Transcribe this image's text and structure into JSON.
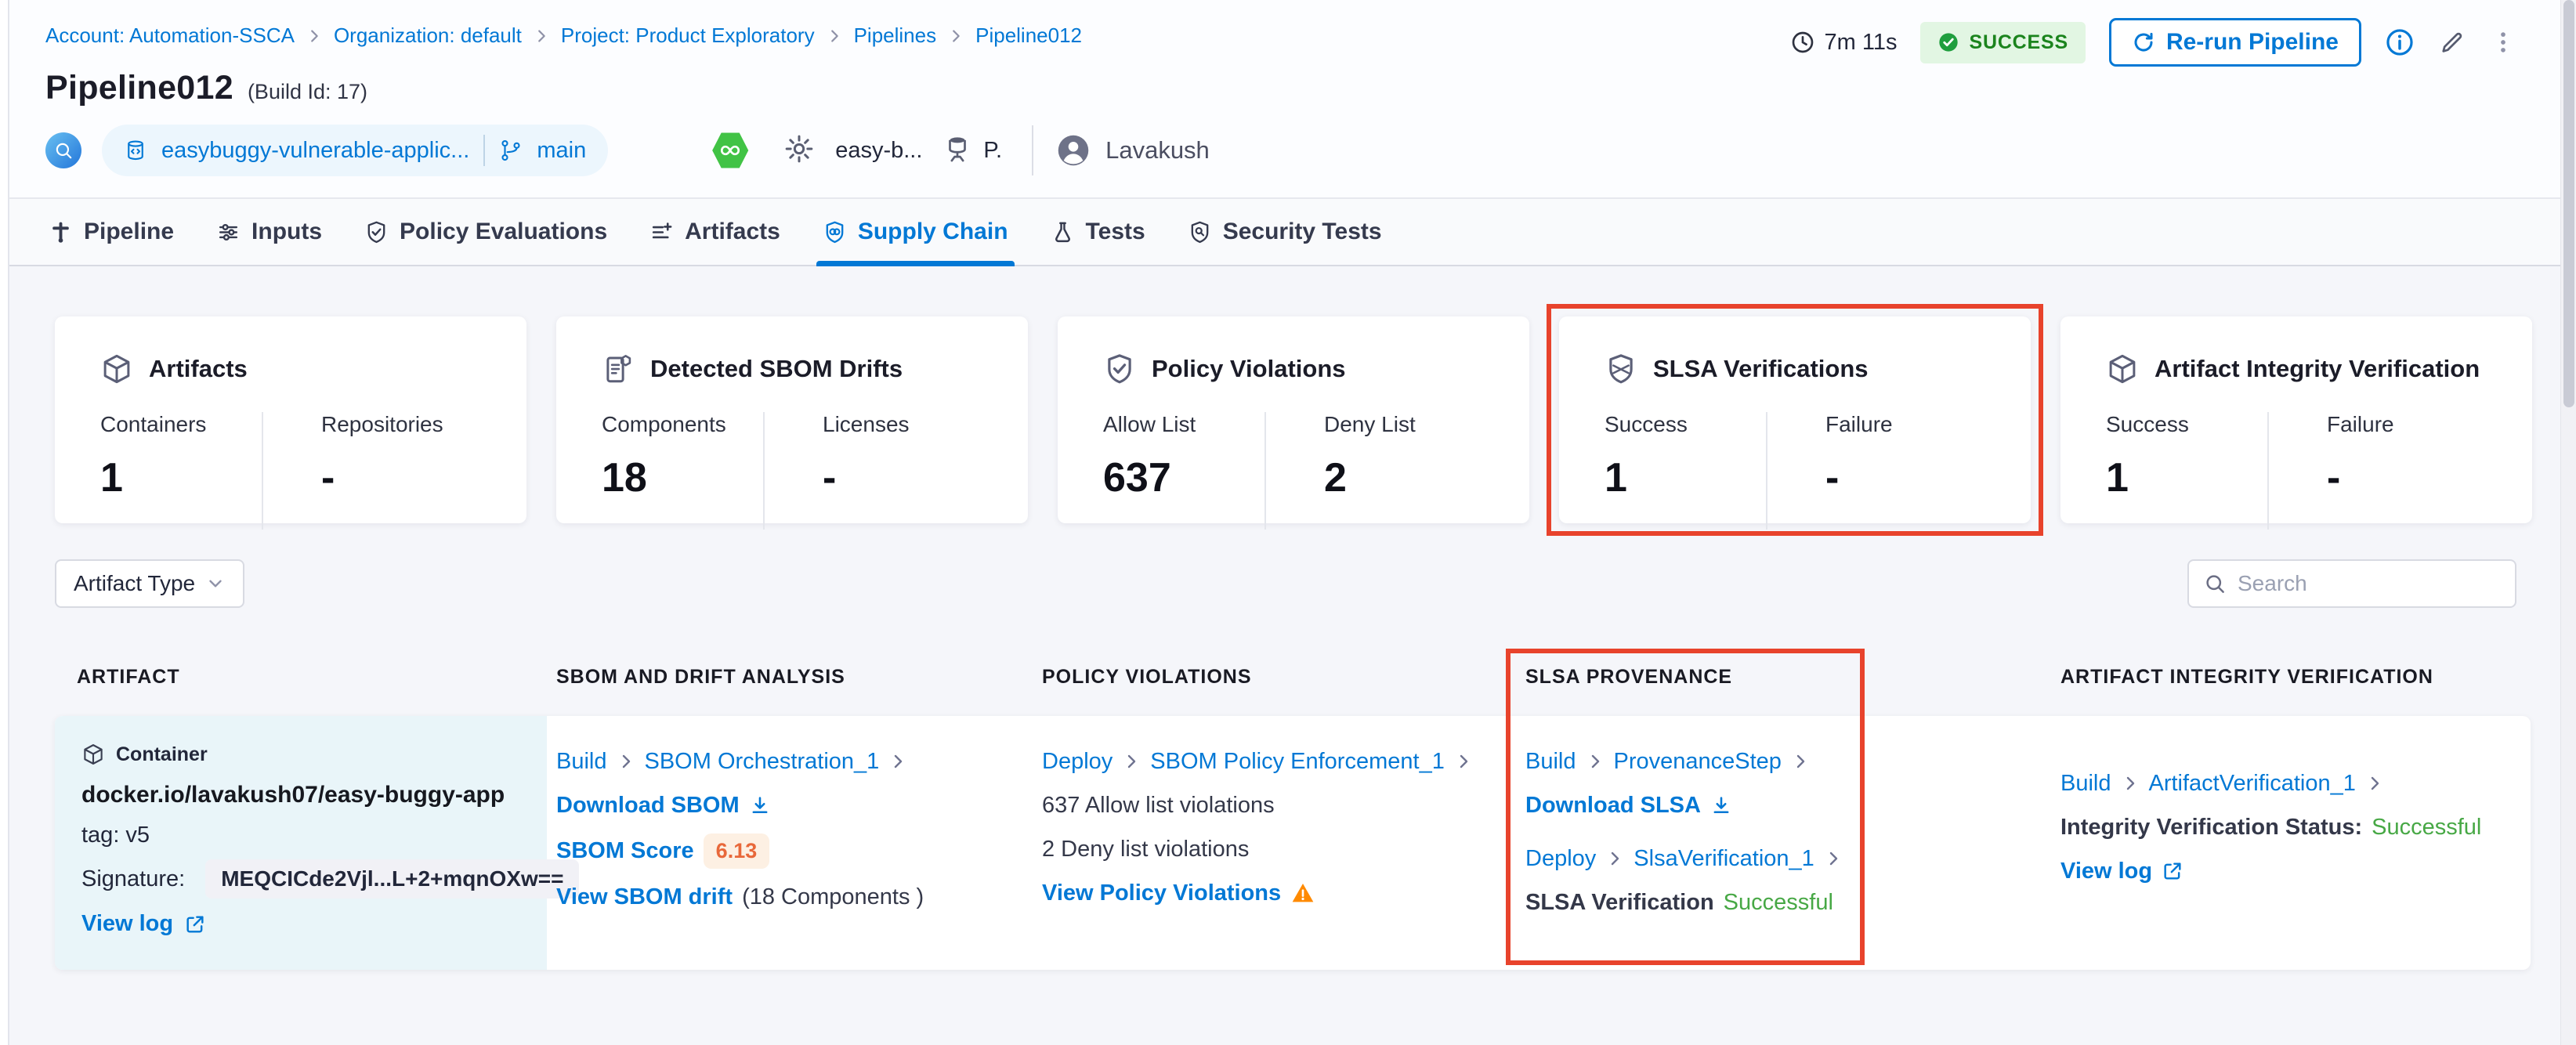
{
  "colors": {
    "accent": "#0278d5",
    "success_text": "#47a845",
    "badge_green": "#1b841d",
    "annotation_red": "#e8432c",
    "score_orange": "#e8683a"
  },
  "breadcrumb": {
    "items": [
      "Account: Automation-SSCA",
      "Organization: default",
      "Project: Product Exploratory",
      "Pipelines",
      "Pipeline012"
    ]
  },
  "topbar": {
    "duration": "7m 11s",
    "status_label": "SUCCESS",
    "rerun_label": "Re-run Pipeline"
  },
  "title": {
    "name": "Pipeline012",
    "build": "(Build Id: 17)"
  },
  "meta": {
    "repo": "easybuggy-vulnerable-applic...",
    "branch": "main",
    "config_name": "easy-b...",
    "env_short": "P.",
    "user": "Lavakush"
  },
  "tabs": [
    {
      "label": "Pipeline"
    },
    {
      "label": "Inputs"
    },
    {
      "label": "Policy Evaluations"
    },
    {
      "label": "Artifacts"
    },
    {
      "label": "Supply Chain"
    },
    {
      "label": "Tests"
    },
    {
      "label": "Security Tests"
    }
  ],
  "cards": [
    {
      "title": "Artifacts",
      "stats": [
        {
          "label": "Containers",
          "value": "1"
        },
        {
          "label": "Repositories",
          "value": "-"
        }
      ]
    },
    {
      "title": "Detected SBOM Drifts",
      "stats": [
        {
          "label": "Components",
          "value": "18"
        },
        {
          "label": "Licenses",
          "value": "-"
        }
      ]
    },
    {
      "title": "Policy Violations",
      "stats": [
        {
          "label": "Allow List",
          "value": "637"
        },
        {
          "label": "Deny List",
          "value": "2"
        }
      ]
    },
    {
      "title": "SLSA Verifications",
      "stats": [
        {
          "label": "Success",
          "value": "1"
        },
        {
          "label": "Failure",
          "value": "-"
        }
      ]
    },
    {
      "title": "Artifact Integrity Verification",
      "stats": [
        {
          "label": "Success",
          "value": "1"
        },
        {
          "label": "Failure",
          "value": "-"
        }
      ]
    }
  ],
  "filters": {
    "artifact_type": "Artifact Type",
    "search_placeholder": "Search"
  },
  "table": {
    "headers": [
      "ARTIFACT",
      "SBOM AND DRIFT ANALYSIS",
      "POLICY VIOLATIONS",
      "SLSA PROVENANCE",
      "ARTIFACT INTEGRITY VERIFICATION"
    ],
    "row": {
      "artifact": {
        "type": "Container",
        "image": "docker.io/lavakush07/easy-buggy-app",
        "tag": "tag: v5",
        "signature_label": "Signature:",
        "signature": "MEQCICde2Vjl...L+2+mqnOXw==",
        "view_log": "View log"
      },
      "sbom": {
        "stage": "Build",
        "step": "SBOM Orchestration_1",
        "download": "Download SBOM",
        "score_label": "SBOM Score",
        "score": "6.13",
        "drift": "View SBOM drift",
        "components": "(18 Components )"
      },
      "policy": {
        "stage": "Deploy",
        "step": "SBOM Policy Enforcement_1",
        "allow": "637 Allow list violations",
        "deny": "2 Deny list violations",
        "view": "View Policy Violations"
      },
      "slsa": {
        "stage1": "Build",
        "step1": "ProvenanceStep",
        "download": "Download SLSA",
        "stage2": "Deploy",
        "step2": "SlsaVerification_1",
        "status_label": "SLSA Verification",
        "status": "Successful"
      },
      "integrity": {
        "stage": "Build",
        "step": "ArtifactVerification_1",
        "status_label": "Integrity Verification Status:",
        "status": "Successful",
        "view_log": "View log"
      }
    }
  }
}
